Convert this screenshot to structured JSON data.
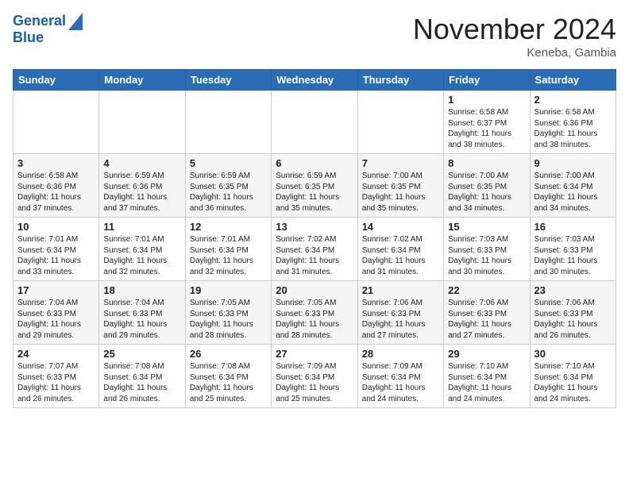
{
  "header": {
    "logo_line1": "General",
    "logo_line2": "Blue",
    "month": "November 2024",
    "location": "Keneba, Gambia"
  },
  "weekdays": [
    "Sunday",
    "Monday",
    "Tuesday",
    "Wednesday",
    "Thursday",
    "Friday",
    "Saturday"
  ],
  "weeks": [
    [
      {
        "day": "",
        "info": ""
      },
      {
        "day": "",
        "info": ""
      },
      {
        "day": "",
        "info": ""
      },
      {
        "day": "",
        "info": ""
      },
      {
        "day": "",
        "info": ""
      },
      {
        "day": "1",
        "info": "Sunrise: 6:58 AM\nSunset: 6:37 PM\nDaylight: 11 hours\nand 38 minutes."
      },
      {
        "day": "2",
        "info": "Sunrise: 6:58 AM\nSunset: 6:36 PM\nDaylight: 11 hours\nand 38 minutes."
      }
    ],
    [
      {
        "day": "3",
        "info": "Sunrise: 6:58 AM\nSunset: 6:36 PM\nDaylight: 11 hours\nand 37 minutes."
      },
      {
        "day": "4",
        "info": "Sunrise: 6:59 AM\nSunset: 6:36 PM\nDaylight: 11 hours\nand 37 minutes."
      },
      {
        "day": "5",
        "info": "Sunrise: 6:59 AM\nSunset: 6:35 PM\nDaylight: 11 hours\nand 36 minutes."
      },
      {
        "day": "6",
        "info": "Sunrise: 6:59 AM\nSunset: 6:35 PM\nDaylight: 11 hours\nand 35 minutes."
      },
      {
        "day": "7",
        "info": "Sunrise: 7:00 AM\nSunset: 6:35 PM\nDaylight: 11 hours\nand 35 minutes."
      },
      {
        "day": "8",
        "info": "Sunrise: 7:00 AM\nSunset: 6:35 PM\nDaylight: 11 hours\nand 34 minutes."
      },
      {
        "day": "9",
        "info": "Sunrise: 7:00 AM\nSunset: 6:34 PM\nDaylight: 11 hours\nand 34 minutes."
      }
    ],
    [
      {
        "day": "10",
        "info": "Sunrise: 7:01 AM\nSunset: 6:34 PM\nDaylight: 11 hours\nand 33 minutes."
      },
      {
        "day": "11",
        "info": "Sunrise: 7:01 AM\nSunset: 6:34 PM\nDaylight: 11 hours\nand 32 minutes."
      },
      {
        "day": "12",
        "info": "Sunrise: 7:01 AM\nSunset: 6:34 PM\nDaylight: 11 hours\nand 32 minutes."
      },
      {
        "day": "13",
        "info": "Sunrise: 7:02 AM\nSunset: 6:34 PM\nDaylight: 11 hours\nand 31 minutes."
      },
      {
        "day": "14",
        "info": "Sunrise: 7:02 AM\nSunset: 6:34 PM\nDaylight: 11 hours\nand 31 minutes."
      },
      {
        "day": "15",
        "info": "Sunrise: 7:03 AM\nSunset: 6:33 PM\nDaylight: 11 hours\nand 30 minutes."
      },
      {
        "day": "16",
        "info": "Sunrise: 7:03 AM\nSunset: 6:33 PM\nDaylight: 11 hours\nand 30 minutes."
      }
    ],
    [
      {
        "day": "17",
        "info": "Sunrise: 7:04 AM\nSunset: 6:33 PM\nDaylight: 11 hours\nand 29 minutes."
      },
      {
        "day": "18",
        "info": "Sunrise: 7:04 AM\nSunset: 6:33 PM\nDaylight: 11 hours\nand 29 minutes."
      },
      {
        "day": "19",
        "info": "Sunrise: 7:05 AM\nSunset: 6:33 PM\nDaylight: 11 hours\nand 28 minutes."
      },
      {
        "day": "20",
        "info": "Sunrise: 7:05 AM\nSunset: 6:33 PM\nDaylight: 11 hours\nand 28 minutes."
      },
      {
        "day": "21",
        "info": "Sunrise: 7:06 AM\nSunset: 6:33 PM\nDaylight: 11 hours\nand 27 minutes."
      },
      {
        "day": "22",
        "info": "Sunrise: 7:06 AM\nSunset: 6:33 PM\nDaylight: 11 hours\nand 27 minutes."
      },
      {
        "day": "23",
        "info": "Sunrise: 7:06 AM\nSunset: 6:33 PM\nDaylight: 11 hours\nand 26 minutes."
      }
    ],
    [
      {
        "day": "24",
        "info": "Sunrise: 7:07 AM\nSunset: 6:33 PM\nDaylight: 11 hours\nand 26 minutes."
      },
      {
        "day": "25",
        "info": "Sunrise: 7:08 AM\nSunset: 6:34 PM\nDaylight: 11 hours\nand 26 minutes."
      },
      {
        "day": "26",
        "info": "Sunrise: 7:08 AM\nSunset: 6:34 PM\nDaylight: 11 hours\nand 25 minutes."
      },
      {
        "day": "27",
        "info": "Sunrise: 7:09 AM\nSunset: 6:34 PM\nDaylight: 11 hours\nand 25 minutes."
      },
      {
        "day": "28",
        "info": "Sunrise: 7:09 AM\nSunset: 6:34 PM\nDaylight: 11 hours\nand 24 minutes."
      },
      {
        "day": "29",
        "info": "Sunrise: 7:10 AM\nSunset: 6:34 PM\nDaylight: 11 hours\nand 24 minutes."
      },
      {
        "day": "30",
        "info": "Sunrise: 7:10 AM\nSunset: 6:34 PM\nDaylight: 11 hours\nand 24 minutes."
      }
    ]
  ]
}
